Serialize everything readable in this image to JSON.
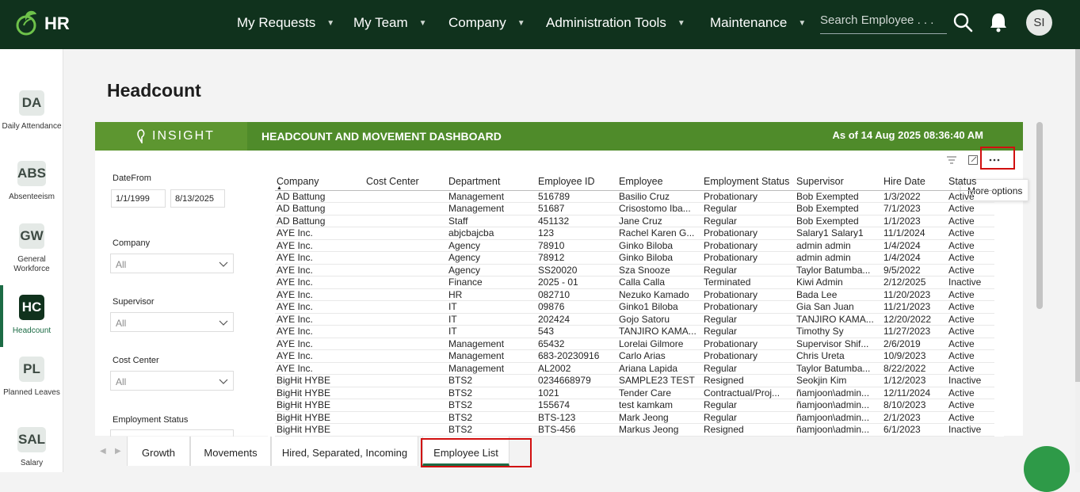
{
  "app": {
    "logo_text": "HR"
  },
  "nav": {
    "items": [
      {
        "label": "My Requests"
      },
      {
        "label": "My Team"
      },
      {
        "label": "Company"
      },
      {
        "label": "Administration Tools"
      },
      {
        "label": "Maintenance"
      }
    ],
    "search_placeholder": "Search Employee . . .",
    "avatar_initials": "SI"
  },
  "sidebar": {
    "items": [
      {
        "badge": "DA",
        "label": "Daily Attendance"
      },
      {
        "badge": "ABS",
        "label": "Absenteeism"
      },
      {
        "badge": "GW",
        "label": "General Workforce"
      },
      {
        "badge": "HC",
        "label": "Headcount",
        "active": true
      },
      {
        "badge": "PL",
        "label": "Planned Leaves"
      },
      {
        "badge": "SAL",
        "label": "Salary"
      }
    ]
  },
  "page": {
    "title": "Headcount"
  },
  "report": {
    "brand": "INSIGHT",
    "title": "HEADCOUNT AND MOVEMENT DASHBOARD",
    "as_of": "As of 14 Aug 2025 08:36:40 AM",
    "filters": {
      "date_label": "DateFrom",
      "date_from": "1/1/1999",
      "date_to": "8/13/2025",
      "company_label": "Company",
      "company_value": "All",
      "supervisor_label": "Supervisor",
      "supervisor_value": "All",
      "cost_center_label": "Cost Center",
      "cost_center_value": "All",
      "employment_status_label": "Employment Status"
    },
    "tooltip": "More options",
    "table": {
      "columns": [
        "Company",
        "Cost Center",
        "Department",
        "Employee ID",
        "Employee",
        "Employment Status",
        "Supervisor",
        "Hire Date",
        "Status"
      ],
      "rows": [
        [
          "AD Battung",
          "",
          "Management",
          "516789",
          "Basilio Cruz",
          "Probationary",
          "Bob Exempted",
          "1/3/2022",
          "Active"
        ],
        [
          "AD Battung",
          "",
          "Management",
          "51687",
          "Crisostomo Iba...",
          "Regular",
          "Bob Exempted",
          "7/1/2023",
          "Active"
        ],
        [
          "AD Battung",
          "",
          "Staff",
          "451132",
          "Jane Cruz",
          "Regular",
          "Bob Exempted",
          "1/1/2023",
          "Active"
        ],
        [
          "AYE Inc.",
          "",
          "abjcbajcba",
          "123",
          "Rachel Karen G...",
          "Probationary",
          "Salary1 Salary1",
          "11/1/2024",
          "Active"
        ],
        [
          "AYE Inc.",
          "",
          "Agency",
          "78910",
          "Ginko Biloba",
          "Probationary",
          "admin admin",
          "1/4/2024",
          "Active"
        ],
        [
          "AYE Inc.",
          "",
          "Agency",
          "78912",
          "Ginko Biloba",
          "Probationary",
          "admin admin",
          "1/4/2024",
          "Active"
        ],
        [
          "AYE Inc.",
          "",
          "Agency",
          "SS20020",
          "Sza Snooze",
          "Regular",
          "Taylor Batumba...",
          "9/5/2022",
          "Active"
        ],
        [
          "AYE Inc.",
          "",
          "Finance",
          "2025 - 01",
          "Calla Calla",
          "Terminated",
          "Kiwi Admin",
          "2/12/2025",
          "Inactive"
        ],
        [
          "AYE Inc.",
          "",
          "HR",
          "082710",
          "Nezuko Kamado",
          "Probationary",
          "Bada Lee",
          "11/20/2023",
          "Active"
        ],
        [
          "AYE Inc.",
          "",
          "IT",
          "09876",
          "Ginko1 Biloba",
          "Probationary",
          "Gia San Juan",
          "11/21/2023",
          "Active"
        ],
        [
          "AYE Inc.",
          "",
          "IT",
          "202424",
          "Gojo Satoru",
          "Regular",
          "TANJIRO KAMA...",
          "12/20/2022",
          "Active"
        ],
        [
          "AYE Inc.",
          "",
          "IT",
          "543",
          "TANJIRO KAMA...",
          "Regular",
          "Timothy Sy",
          "11/27/2023",
          "Active"
        ],
        [
          "AYE Inc.",
          "",
          "Management",
          "65432",
          "Lorelai Gilmore",
          "Probationary",
          "Supervisor Shif...",
          "2/6/2019",
          "Active"
        ],
        [
          "AYE Inc.",
          "",
          "Management",
          "683-20230916",
          "Carlo Arias",
          "Probationary",
          "Chris Ureta",
          "10/9/2023",
          "Active"
        ],
        [
          "AYE Inc.",
          "",
          "Management",
          "AL2002",
          "Ariana Lapida",
          "Regular",
          "Taylor Batumba...",
          "8/22/2022",
          "Active"
        ],
        [
          "BigHit HYBE",
          "",
          "BTS2",
          "0234668979",
          "SAMPLE23 TEST",
          "Resigned",
          "Seokjin Kim",
          "1/12/2023",
          "Inactive"
        ],
        [
          "BigHit HYBE",
          "",
          "BTS2",
          "1021",
          "Tender Care",
          "Contractual/Proj...",
          "ñamjoon\\admin...",
          "12/11/2024",
          "Active"
        ],
        [
          "BigHit HYBE",
          "",
          "BTS2",
          "155674",
          "test kamkam",
          "Regular",
          "ñamjoon\\admin...",
          "8/10/2023",
          "Active"
        ],
        [
          "BigHit HYBE",
          "",
          "BTS2",
          "BTS-123",
          "Mark Jeong",
          "Regular",
          "ñamjoon\\admin...",
          "2/1/2023",
          "Active"
        ],
        [
          "BigHit HYBE",
          "",
          "BTS2",
          "BTS-456",
          "Markus Jeong",
          "Resigned",
          "ñamjoon\\admin...",
          "6/1/2023",
          "Inactive"
        ]
      ]
    },
    "tabs": [
      "Growth",
      "Movements",
      "Hired, Separated, Incoming",
      "Employee List"
    ],
    "active_tab": "Employee List"
  },
  "colors": {
    "topbar": "#10321d",
    "banner_green": "#4f8b2a",
    "accent": "#1c6b45",
    "highlight_box": "#d10f0f"
  }
}
